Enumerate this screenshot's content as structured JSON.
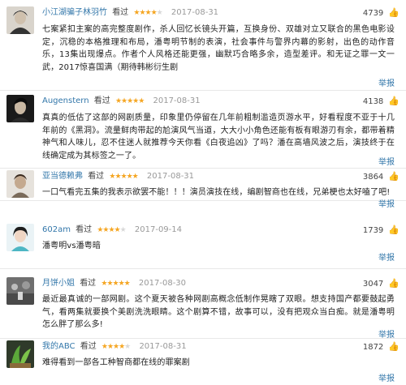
{
  "comments": [
    {
      "username": "小江湖骗子林羽竹",
      "watched_label": "看过",
      "rating": 4,
      "date": "2017-08-31",
      "useful_count": "4739",
      "text": "七案紧扣主案的高完整度剧作，杀人回忆长镜头开篇，互换身份、双雄对立又联合的黑色电影设定，沉稳的本格推理和布局，潘粤明节制的表演，社会事件与警界内幕的影射，出色的动作音乐，13集出现爆点。作者个人风格还能更强，幽默巧合略多余，造型差评。和无证之罪一文一武，2017惊喜国满（期待韩彬衍生剧",
      "report_label": "举报",
      "avatar": "avatar-user-1"
    },
    {
      "username": "Augenstern",
      "watched_label": "看过",
      "rating": 5,
      "date": "2017-08-31",
      "useful_count": "4138",
      "text": "真真的低估了这部的网剧质量，印象里仍停留在几年前粗制滥造页游水平，好看程度不亚于十几年前的《黑洞》。流量鲜肉带起的尬演风气当道，大大小小角色还能有板有眼游刃有余，都带着精神气和人味儿，忍不住迷人就推荐今天你看《白夜追凶》了吗？潘在高墙风波之后，演技终于在线确定成为其标签之一了。",
      "report_label": "举报",
      "avatar": "avatar-user-2"
    },
    {
      "username": "亚当德赖弗",
      "watched_label": "看过",
      "rating": 5,
      "date": "2017-08-31",
      "useful_count": "3864",
      "text": "一口气看完五集的我表示欲罢不能！！！演员演技在线，编剧智商也在线，兄弟梗也太好嗑了吧!",
      "report_label": "举报",
      "avatar": "avatar-user-3"
    },
    {
      "username": "602am",
      "watched_label": "看过",
      "rating": 4,
      "date": "2017-09-14",
      "useful_count": "1739",
      "text": "潘粤明vs潘粤暗",
      "report_label": "举报",
      "avatar": "avatar-user-4"
    },
    {
      "username": "月饼小姐",
      "watched_label": "看过",
      "rating": 5,
      "date": "2017-08-30",
      "useful_count": "3047",
      "text": "最近最真诚的一部网剧。这个夏天被各种网剧高概念低制作晃瞎了双眼。想支持国产都要鼓起勇气，看两集就要换个美剧洗洗眼睛。这个剧算不错，故事可以，没有把观众当白痴。就是潘粤明怎么胖了那么多!",
      "report_label": "举报",
      "avatar": "avatar-user-5"
    },
    {
      "username": "我的ABC",
      "watched_label": "看过",
      "rating": 4,
      "date": "2017-08-31",
      "useful_count": "1872",
      "text": "难得看到一部各工种智商都在线的罪案剧",
      "report_label": "举报",
      "avatar": "avatar-user-6"
    }
  ],
  "colors": {
    "username": "#3377aa",
    "star": "#f5a623",
    "date": "#999999"
  },
  "icons": {
    "useful": "thumbs-up-icon"
  }
}
